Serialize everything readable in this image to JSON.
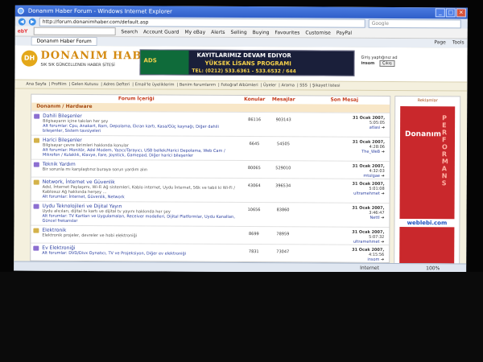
{
  "window": {
    "title": "Donanım Haber Forum - Windows Internet Explorer"
  },
  "address": {
    "url": "http://forum.donanimhaber.com/default.asp",
    "search_placeholder": "Google"
  },
  "ebay_toolbar": {
    "logo": "ebY",
    "items": [
      "Search",
      "Account Guard",
      "My eBay",
      "Alerts",
      "Selling",
      "Buying",
      "Favourites",
      "Customise",
      "PayPal"
    ]
  },
  "tabs": {
    "active": "Donanım Haber Forum",
    "tools": [
      "Page",
      "Tools"
    ]
  },
  "site": {
    "logo_text": "DONANIM HABER",
    "logo_sub": "SIK SIK GÜNCELLENEN HABER SİTESİ",
    "ad_line1": "KAYITLARIMIZ DEVAM EDIYOR",
    "ad_line2": "YÜKSEK LİSANS PROGRAMI",
    "ad_line3": "TEL: (0212) 533.6361 - 533.6532 / 644",
    "login_text": "Giriş yaptığınız ad",
    "login_user": "insom",
    "login_button": "Çıkış"
  },
  "menu": [
    "Ana Sayfa",
    "Profilim",
    "Gelen Kutusu",
    "Adres Defteri",
    "Email'le üyeliklerim",
    "Benim forumlarım",
    "Fotoğraf Albümleri",
    "Üyeler",
    "Arama",
    "SSS",
    "Şikayet listesi"
  ],
  "forum": {
    "col_content": "Forum İçeriği",
    "col_topics": "Konular",
    "col_posts": "Mesajlar",
    "col_last": "Son Mesaj",
    "category": "Donanım / Hardware",
    "rows": [
      {
        "title": "Dahili Bileşenler",
        "desc": "Bilgisayarın içine takılan her şey",
        "subs": "Alt forumlar: Cpu, Anakart, Ram, Depolama, Ekran kartı, Kasa/Güç kaynağı, Diğer dahili bileşenler, Sistem tavsiyeleri",
        "topics": "86116",
        "posts": "903143",
        "date": "31 Ocak 2007,",
        "time": "5:05:05",
        "user": "atlasi"
      },
      {
        "title": "Harici Bileşenler",
        "desc": "Bilgisayar çevre birimleri hakkında konular",
        "subs": "Alt forumlar: Monitör, Adsl Modem, Yazıcı/Tarayıcı, USB bellek/Harici Depolama, Web Cam / Mikrofon / Kulaklık, Klavye, Fare, Joystick, Gamepad, Diğer harici bileşenler",
        "topics": "6645",
        "posts": "54505",
        "date": "31 Ocak 2007,",
        "time": "4:28:06",
        "user": "The_WeB"
      },
      {
        "title": "Teknik Yardım",
        "desc": "Bir sorunla mı karşılaştınız buraya sorun yardım alın",
        "subs": "",
        "topics": "80065",
        "posts": "529010",
        "date": "31 Ocak 2007,",
        "time": "4:32:03",
        "user": "mtolgae"
      },
      {
        "title": "Network, İnternet ve Güvenlik",
        "desc": "Adsl, İnternet Paylaşımı, Wi-Fi Ağ sistemleri, Kablo internet, Uydu İnternet, 56k ve tabii ki Wi-Fi / Kablosuz Ağ hakkında herşey ...",
        "subs": "Alt forumlar: İnternet, Güvenlik, Network",
        "topics": "43064",
        "posts": "396534",
        "date": "31 Ocak 2007,",
        "time": "5:01:08",
        "user": "ultramehmet"
      },
      {
        "title": "Uydu Teknolojileri ve Dijital Yayın",
        "desc": "Uydu alıcıları, dijital tv kartı ve dijital tv yayını hakkında her şey",
        "subs": "Alt forumlar: TV Kartları ve Uygulamaları, Receiver modelleri, Dijital Platformlar, Uydu Kanalları, Güncel frekanslar",
        "topics": "10656",
        "posts": "83860",
        "date": "31 Ocak 2007,",
        "time": "3:46:47",
        "user": "Nettl"
      },
      {
        "title": "Elektronik",
        "desc": "Elektronik projeler, devreler ve hobi elektroniği",
        "subs": "",
        "topics": "8699",
        "posts": "78959",
        "date": "31 Ocak 2007,",
        "time": "5:07:32",
        "user": "ultramehmet"
      },
      {
        "title": "Ev Elektroniği",
        "desc": "",
        "subs": "Alt forumlar: DVD/Divx Oynatıcı, TV ve Projeksiyon, Diğer ev elektroniği",
        "topics": "7831",
        "posts": "73047",
        "date": "31 Ocak 2007,",
        "time": "4:15:56",
        "user": "insom"
      }
    ]
  },
  "ad_side": {
    "header": "Reklamlar",
    "brand": "Donanım",
    "vertical": "PERFORMANS",
    "footer": "weblebi.com"
  },
  "status": {
    "zone": "Internet",
    "zoom": "100%"
  }
}
